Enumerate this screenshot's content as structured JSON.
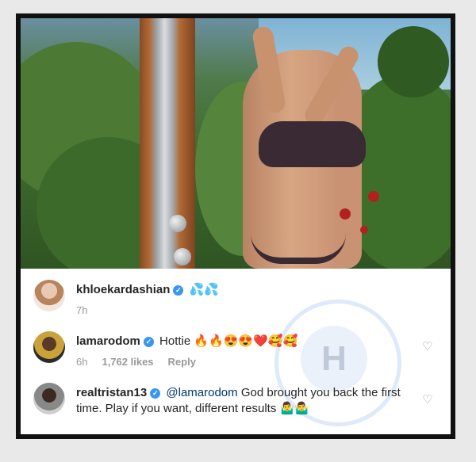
{
  "comments": [
    {
      "username": "khloekardashian",
      "verified": true,
      "text": "💦💦",
      "time": "7h",
      "likes": "",
      "reply": ""
    },
    {
      "username": "lamarodom",
      "verified": true,
      "text": "Hottie 🔥🔥😍😍❤️🥰🥰",
      "time": "6h",
      "likes": "1,762 likes",
      "reply": "Reply"
    },
    {
      "username": "realtristan13",
      "verified": true,
      "mention": "@lamarodom",
      "text": "God brought you back the first time. Play if you want, different results 🤷‍♂️🤷‍♂️"
    }
  ],
  "icons": {
    "verified": "verified-badge-icon",
    "heart": "heart-outline-icon"
  },
  "colors": {
    "verified": "#3897f0",
    "text": "#262626",
    "meta": "#999999",
    "mention": "#003569"
  }
}
